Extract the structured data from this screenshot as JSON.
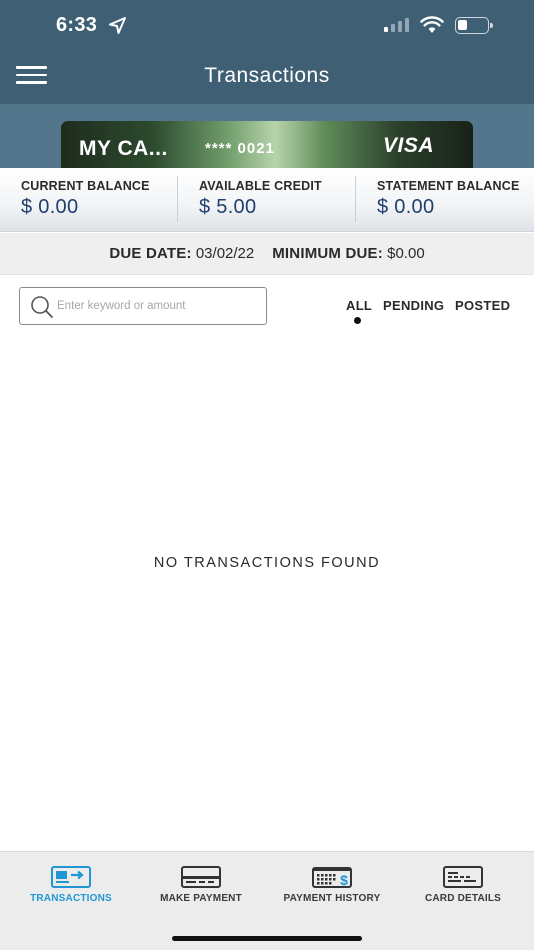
{
  "status_bar": {
    "time": "6:33"
  },
  "header": {
    "title": "Transactions"
  },
  "card": {
    "name": "MY CA...",
    "masked_number": "**** 0021",
    "network": "VISA"
  },
  "balances": [
    {
      "label": "CURRENT BALANCE",
      "value": "$ 0.00"
    },
    {
      "label": "AVAILABLE CREDIT",
      "value": "$ 5.00"
    },
    {
      "label": "STATEMENT BALANCE",
      "value": "$ 0.00"
    }
  ],
  "due": {
    "date_label": "DUE DATE:",
    "date_value": "03/02/22",
    "min_label": "MINIMUM DUE:",
    "min_value": "$0.00"
  },
  "search": {
    "placeholder": "Enter keyword or amount",
    "value": ""
  },
  "filters": {
    "selected": "ALL",
    "items": [
      "ALL",
      "PENDING",
      "POSTED"
    ]
  },
  "empty_message": "NO TRANSACTIONS FOUND",
  "tabs": [
    {
      "label": "TRANSACTIONS",
      "icon": "transactions-icon",
      "active": true
    },
    {
      "label": "MAKE PAYMENT",
      "icon": "make-payment-icon",
      "active": false
    },
    {
      "label": "PAYMENT HISTORY",
      "icon": "payment-history-icon",
      "active": false
    },
    {
      "label": "CARD DETAILS",
      "icon": "card-details-icon",
      "active": false
    }
  ],
  "colors": {
    "header": "#3f5f74",
    "accent": "#1f97d4",
    "balance_value": "#1f3f6e"
  }
}
